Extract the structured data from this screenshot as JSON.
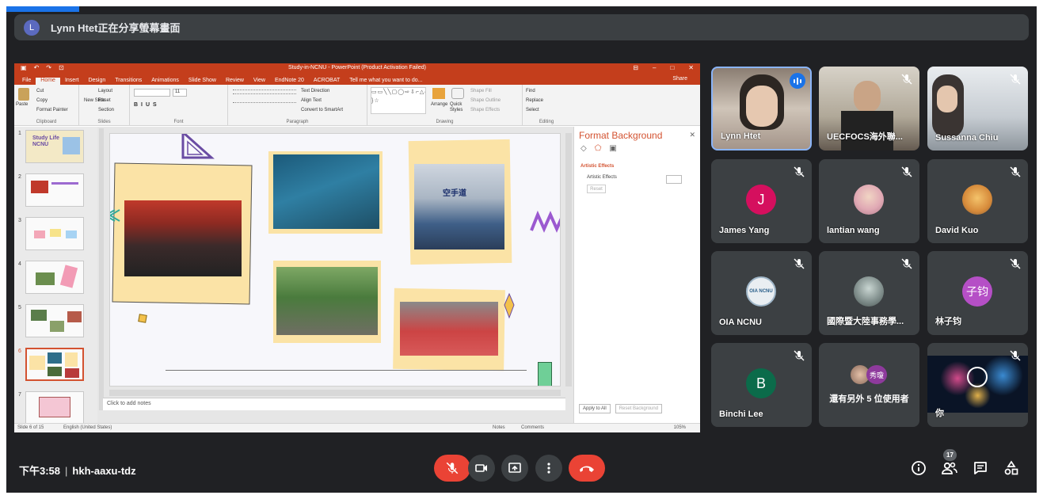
{
  "banner": {
    "avatar_letter": "L",
    "text": "Lynn Htet正在分享螢幕畫面"
  },
  "powerpoint": {
    "title": "Study-in-NCNU - PowerPoint (Product Activation Failed)",
    "share_label": "Share",
    "tabs": [
      "File",
      "Home",
      "Insert",
      "Design",
      "Transitions",
      "Animations",
      "Slide Show",
      "Review",
      "View",
      "EndNote 20",
      "ACROBAT",
      "Tell me what you want to do..."
    ],
    "ribbon": {
      "clipboard": {
        "paste": "Paste",
        "cut": "Cut",
        "copy": "Copy",
        "format_painter": "Format Painter",
        "label": "Clipboard"
      },
      "slides": {
        "new_slide": "New Slide",
        "layout": "Layout",
        "reset": "Reset",
        "section": "Section",
        "label": "Slides"
      },
      "font": {
        "size": "11",
        "label": "Font"
      },
      "paragraph": {
        "text_direction": "Text Direction",
        "align_text": "Align Text",
        "convert": "Convert to SmartArt",
        "label": "Paragraph"
      },
      "drawing": {
        "arrange": "Arrange",
        "quick_styles": "Quick Styles",
        "shape_fill": "Shape Fill",
        "shape_outline": "Shape Outline",
        "shape_effects": "Shape Effects",
        "label": "Drawing"
      },
      "editing": {
        "find": "Find",
        "replace": "Replace",
        "select": "Select",
        "label": "Editing"
      }
    },
    "slide_numbers": [
      "1",
      "2",
      "3",
      "4",
      "5",
      "6",
      "7"
    ],
    "thumb1_text": "Study Life NCNU",
    "slide_text": {
      "banner_sign": "空手道"
    },
    "notes_placeholder": "Click to add notes",
    "format_panel": {
      "title": "Format Background",
      "section": "Artistic Effects",
      "row_label": "Artistic Effects",
      "reset": "Reset",
      "apply_all": "Apply to All",
      "reset_background": "Reset Background"
    },
    "status": {
      "slide": "Slide 6 of 15",
      "language": "English (United States)",
      "notes": "Notes",
      "comments": "Comments",
      "zoom": "105%"
    }
  },
  "participants": [
    {
      "name": "Lynn Htet",
      "type": "camera",
      "speaking": true
    },
    {
      "name": "UECFOCS海外聯...",
      "type": "camera",
      "muted": true
    },
    {
      "name": "Sussanna Chiu",
      "type": "camera",
      "muted": true
    },
    {
      "name": "James Yang",
      "type": "letter",
      "letter": "J",
      "color": "#d50f5e",
      "muted": true
    },
    {
      "name": "lantian wang",
      "type": "photo",
      "muted": true
    },
    {
      "name": "David Kuo",
      "type": "photo",
      "muted": true
    },
    {
      "name": "OIA NCNU",
      "type": "logo",
      "logo_text": "OIA NCNU",
      "muted": true
    },
    {
      "name": "國際暨大陸事務學...",
      "type": "photo",
      "muted": true
    },
    {
      "name": "林子钧",
      "type": "letter",
      "letter": "子钧",
      "color": "#b54fc6",
      "muted": true
    },
    {
      "name": "Binchi Lee",
      "type": "letter",
      "letter": "B",
      "color": "#0b6b4a",
      "muted": true
    },
    {
      "name": "還有另外 5 位使用者",
      "type": "others",
      "mini_avatar_text": "秀瓊"
    },
    {
      "name": "你",
      "type": "camera",
      "muted": true
    }
  ],
  "bottom": {
    "time": "下午3:58",
    "meeting_code": "hkh-aaxu-tdz",
    "participant_count": "17"
  }
}
